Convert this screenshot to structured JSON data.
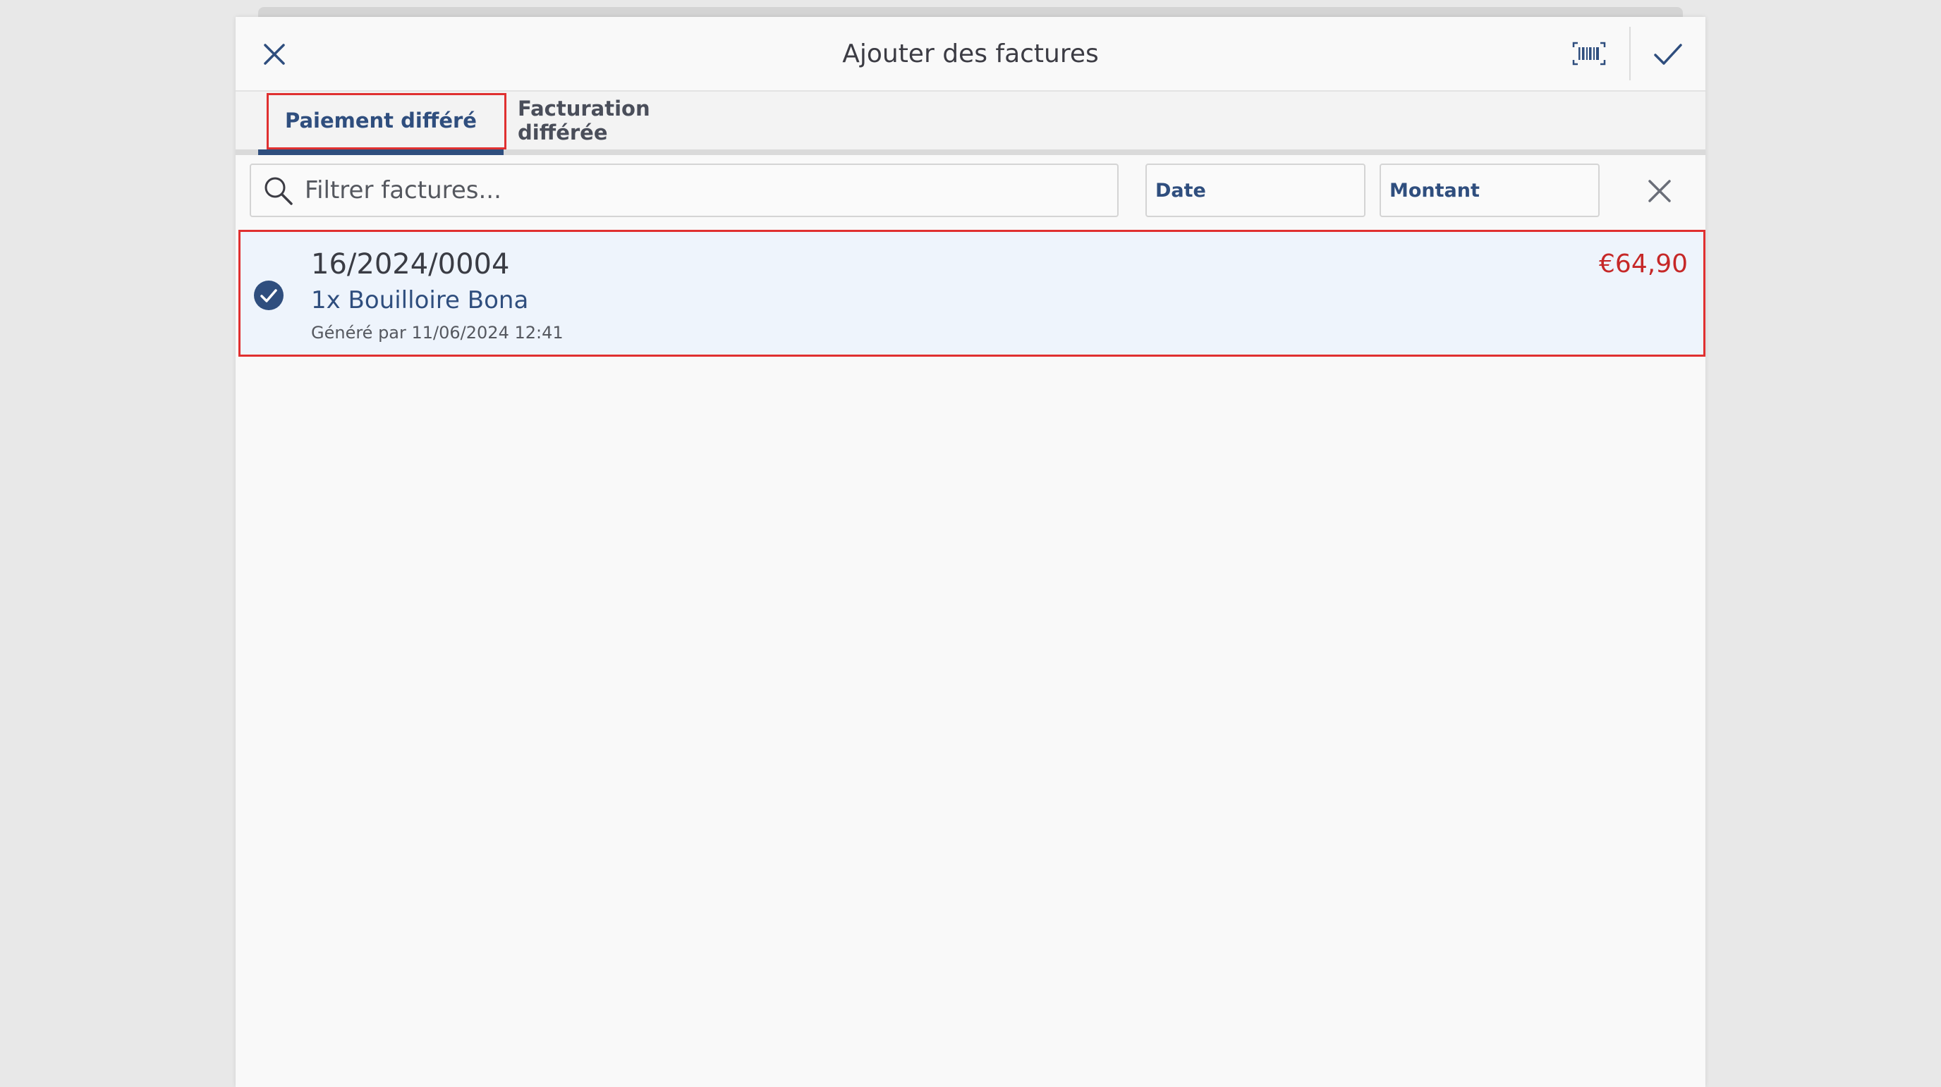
{
  "header": {
    "title": "Ajouter des factures",
    "close_icon": "close-icon",
    "barcode_icon": "barcode-scan-icon",
    "confirm_icon": "checkmark-icon"
  },
  "tabs": [
    {
      "label": "Paiement différé",
      "active": true
    },
    {
      "label": "Facturation différée",
      "active": false
    }
  ],
  "filters": {
    "search_placeholder": "Filtrer factures...",
    "search_value": "",
    "date_label": "Date",
    "amount_label": "Montant",
    "clear_icon": "close-icon"
  },
  "invoices": [
    {
      "number": "16/2024/0004",
      "item": "1x Bouilloire Bona",
      "generated": "Généré par 11/06/2024 12:41",
      "amount": "€64,90",
      "selected": true
    }
  ],
  "colors": {
    "accent": "#2f4e7e",
    "amount": "#c62828",
    "highlight": "#e03030",
    "selected_row_bg": "#eef4fc"
  }
}
